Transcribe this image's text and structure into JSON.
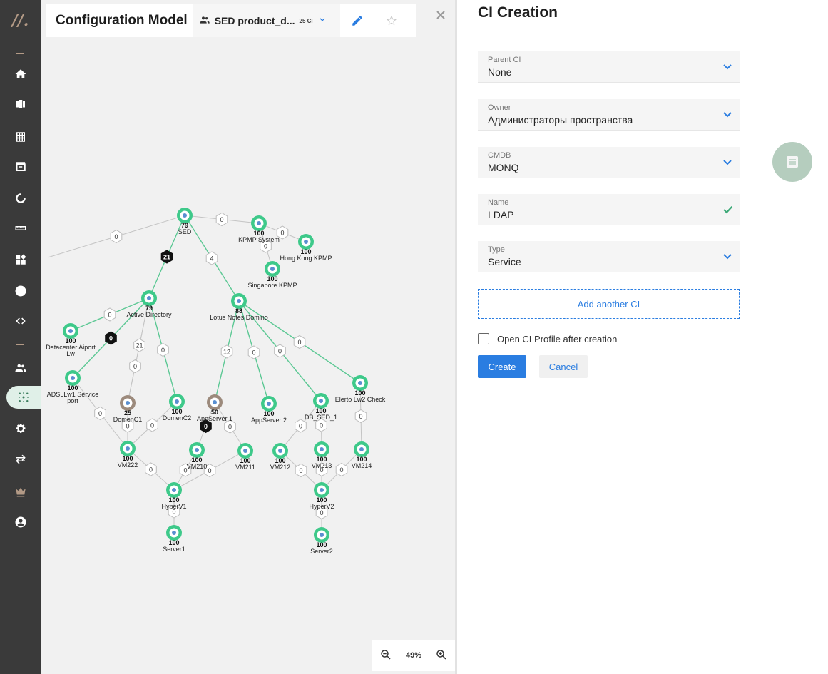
{
  "app": {
    "logo_text": "//."
  },
  "toolbar": {
    "title": "Configuration Model",
    "space_name": "SED product_d...",
    "space_count": "25 CI",
    "zoom_level": "49%"
  },
  "panel": {
    "title": "CI Creation",
    "fields": [
      {
        "label": "Parent CI",
        "value": "None",
        "kind": "select"
      },
      {
        "label": "Owner",
        "value": "Администраторы пространства",
        "kind": "select"
      },
      {
        "label": "CMDB",
        "value": "MONQ",
        "kind": "select"
      },
      {
        "label": "Name",
        "value": "LDAP",
        "kind": "valid"
      },
      {
        "label": "Type",
        "value": "Service",
        "kind": "select"
      }
    ],
    "add_another_label": "Add another CI",
    "open_profile_label": "Open CI Profile after creation",
    "open_profile_checked": false,
    "create_label": "Create",
    "cancel_label": "Cancel"
  },
  "nav_icons": [
    "home-icon",
    "boards-icon",
    "table-icon",
    "archive-icon",
    "refresh-icon",
    "ruler-icon",
    "widgets-icon",
    "lightning-icon",
    "code-icon",
    "users-icon",
    "graph-icon",
    "settings-icon",
    "sync-icon",
    "crown-icon",
    "account-icon"
  ],
  "graph": {
    "nodes": [
      {
        "id": "SED",
        "score": "79",
        "name": "SED",
        "status": "ok"
      },
      {
        "id": "KPMP",
        "score": "100",
        "name": "KPMP System",
        "status": "ok"
      },
      {
        "id": "HK",
        "score": "100",
        "name": "Hong Kong KPMP",
        "status": "ok"
      },
      {
        "id": "SG",
        "score": "100",
        "name": "Singapore KPMP",
        "status": "ok"
      },
      {
        "id": "AD",
        "score": "79",
        "name": "Active Directory",
        "status": "ok"
      },
      {
        "id": "LND",
        "score": "88",
        "name": "Lotus Notes Domino",
        "status": "ok"
      },
      {
        "id": "DCA",
        "score": "100",
        "name": "Datacenter Aiport",
        "name2": "Lw",
        "status": "ok"
      },
      {
        "id": "ADSL",
        "score": "100",
        "name": "ADSLLw1 Service",
        "name2": "port",
        "status": "ok"
      },
      {
        "id": "DC1",
        "score": "25",
        "name": "DomenC1",
        "status": "warn"
      },
      {
        "id": "DC2",
        "score": "100",
        "name": "DomenC2",
        "status": "ok"
      },
      {
        "id": "AS1",
        "score": "50",
        "name": "AppServer 1",
        "status": "warn"
      },
      {
        "id": "AS2",
        "score": "100",
        "name": "AppServer 2",
        "status": "ok"
      },
      {
        "id": "DB",
        "score": "100",
        "name": "DB_SED_1",
        "status": "ok"
      },
      {
        "id": "EL",
        "score": "100",
        "name": "Elerto Lw2 Check",
        "status": "ok"
      },
      {
        "id": "VM222",
        "score": "100",
        "name": "VM222",
        "status": "ok"
      },
      {
        "id": "VM210",
        "score": "100",
        "name": "VM210",
        "status": "ok"
      },
      {
        "id": "VM211",
        "score": "100",
        "name": "VM211",
        "status": "ok"
      },
      {
        "id": "VM212",
        "score": "100",
        "name": "VM212",
        "status": "ok"
      },
      {
        "id": "VM213",
        "score": "100",
        "name": "VM213",
        "status": "ok"
      },
      {
        "id": "VM214",
        "score": "100",
        "name": "VM214",
        "status": "ok"
      },
      {
        "id": "HV1",
        "score": "100",
        "name": "HyperV1",
        "status": "ok"
      },
      {
        "id": "HV2",
        "score": "100",
        "name": "HyperV2",
        "status": "ok"
      },
      {
        "id": "S1",
        "score": "100",
        "name": "Server1",
        "status": "ok"
      },
      {
        "id": "S2",
        "score": "100",
        "name": "Server2",
        "status": "ok"
      }
    ],
    "edges": [
      {
        "from": "AD",
        "to": "SED",
        "label": "21",
        "dark": true,
        "green": true
      },
      {
        "from": "LND",
        "to": "SED",
        "label": "4",
        "green": true
      },
      {
        "from": "KPMP",
        "to": "SED",
        "label": "0"
      },
      {
        "from": "HK",
        "to": "KPMP",
        "label": "0"
      },
      {
        "from": "SG",
        "to": "KPMP",
        "label": "0"
      },
      {
        "from": "EXT",
        "to": "SED",
        "label": "0"
      },
      {
        "from": "DCA",
        "to": "AD",
        "label": "0",
        "green": true
      },
      {
        "from": "ADSL",
        "to": "AD",
        "label": "0",
        "dark": true,
        "green": true
      },
      {
        "from": "DC1",
        "to": "AD",
        "label": "21"
      },
      {
        "from": "DC1",
        "to": "AD",
        "label": "0"
      },
      {
        "from": "DC2",
        "to": "AD",
        "label": "0",
        "green": true
      },
      {
        "from": "AS1",
        "to": "LND",
        "label": "12",
        "green": true
      },
      {
        "from": "AS2",
        "to": "LND",
        "label": "0",
        "green": true
      },
      {
        "from": "DB",
        "to": "LND",
        "label": "0",
        "green": true
      },
      {
        "from": "EL",
        "to": "LND",
        "label": "0",
        "green": true
      },
      {
        "from": "VM222",
        "to": "ADSL",
        "label": "0"
      },
      {
        "from": "VM222",
        "to": "DC1",
        "label": "0"
      },
      {
        "from": "VM222",
        "to": "DC2",
        "label": "0"
      },
      {
        "from": "VM210",
        "to": "AS1",
        "label": "0",
        "dark": true
      },
      {
        "from": "VM211",
        "to": "AS1",
        "label": "0"
      },
      {
        "from": "VM212",
        "to": "DB",
        "label": "0"
      },
      {
        "from": "VM213",
        "to": "DB",
        "label": "0"
      },
      {
        "from": "VM214",
        "to": "EL",
        "label": "0"
      },
      {
        "from": "HV1",
        "to": "VM222",
        "label": "0"
      },
      {
        "from": "HV1",
        "to": "VM210",
        "label": "0"
      },
      {
        "from": "HV1",
        "to": "VM211",
        "label": "0"
      },
      {
        "from": "HV2",
        "to": "VM212",
        "label": "0"
      },
      {
        "from": "HV2",
        "to": "VM213",
        "label": "0"
      },
      {
        "from": "HV2",
        "to": "VM214",
        "label": "0"
      },
      {
        "from": "S1",
        "to": "HV1",
        "label": "0"
      },
      {
        "from": "S2",
        "to": "HV2",
        "label": "0"
      }
    ]
  },
  "colors": {
    "accent": "#2a7de1",
    "node_ok": "#3ec98a",
    "node_warn": "#9c8a7c",
    "rail": "#3a3a3a",
    "valid": "#3aa876"
  }
}
